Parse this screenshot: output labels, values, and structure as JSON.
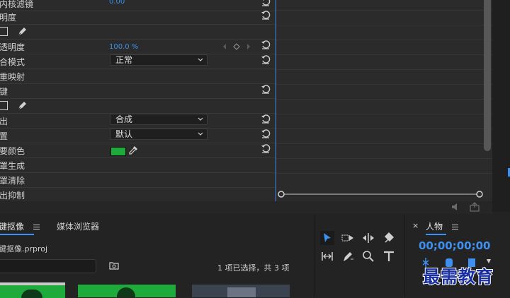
{
  "effect_controls": {
    "rows": [
      {
        "label": "内核滤镜",
        "value": "0.00"
      },
      {
        "label": "明度"
      },
      {
        "label": ""
      },
      {
        "label": "透明度",
        "value": "100.0 %"
      },
      {
        "label": "合模式",
        "dropdown": "正常"
      },
      {
        "label": "重映射"
      },
      {
        "label": "键"
      },
      {
        "label": ""
      },
      {
        "label": "出",
        "dropdown": "合成"
      },
      {
        "label": "置",
        "dropdown": "默认"
      },
      {
        "label": "要颜色",
        "color": "#1fab3c"
      },
      {
        "label": "罩生成"
      },
      {
        "label": "罩清除"
      },
      {
        "label": "出抑制"
      }
    ]
  },
  "project": {
    "tab_active": "键抠像",
    "tab_other": "媒体浏览器",
    "file_name": "键抠像.prproj",
    "selection_status": "1 项已选择，共 3 项",
    "search_placeholder": ""
  },
  "sequence": {
    "tab": "人物",
    "timecode": "00;00;00;00"
  },
  "watermark": "最需教育",
  "colors": {
    "accent": "#3d8ff0",
    "key_color": "#1fab3c"
  }
}
